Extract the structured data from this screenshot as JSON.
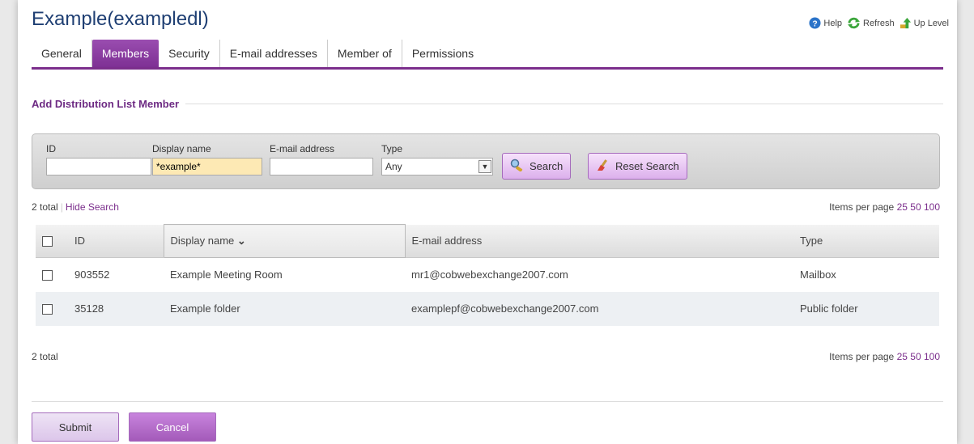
{
  "header": {
    "title": "Example(exampledl)",
    "links": {
      "help": "Help",
      "refresh": "Refresh",
      "up_level": "Up Level"
    }
  },
  "tabs": [
    "General",
    "Members",
    "Security",
    "E-mail addresses",
    "Member of",
    "Permissions"
  ],
  "active_tab": "Members",
  "section_title": "Add Distribution List Member",
  "search": {
    "id_label": "ID",
    "id_value": "",
    "display_name_label": "Display name",
    "display_name_value": "*example*",
    "email_label": "E-mail address",
    "email_value": "",
    "type_label": "Type",
    "type_value": "Any",
    "search_button": "Search",
    "reset_button": "Reset Search"
  },
  "summary_top": {
    "total": "2 total",
    "sep": "|",
    "hide_search": "Hide Search",
    "per_page_label": "Items per page",
    "per_page_options": [
      "25",
      "50",
      "100"
    ]
  },
  "summary_bottom": {
    "total": "2 total",
    "per_page_label": "Items per page",
    "per_page_options": [
      "25",
      "50",
      "100"
    ]
  },
  "table": {
    "columns": [
      "ID",
      "Display name",
      "E-mail address",
      "Type"
    ],
    "sort_indicator": "⌄",
    "rows": [
      {
        "id": "903552",
        "display_name": "Example Meeting Room",
        "email": "mr1@cobwebexchange2007.com",
        "type": "Mailbox"
      },
      {
        "id": "35128",
        "display_name": "Example folder",
        "email": "examplepf@cobwebexchange2007.com",
        "type": "Public folder"
      }
    ]
  },
  "actions": {
    "submit": "Submit",
    "cancel": "Cancel"
  },
  "colors": {
    "brand_purple": "#7b2e8c",
    "title_blue": "#1f3f73",
    "highlight_field": "#fde9b4"
  },
  "icons": {
    "help": "help-circle-icon",
    "refresh": "refresh-arrows-icon",
    "up_level": "up-arrow-icon",
    "search": "magnifier-icon",
    "reset": "eraser-brush-icon"
  }
}
